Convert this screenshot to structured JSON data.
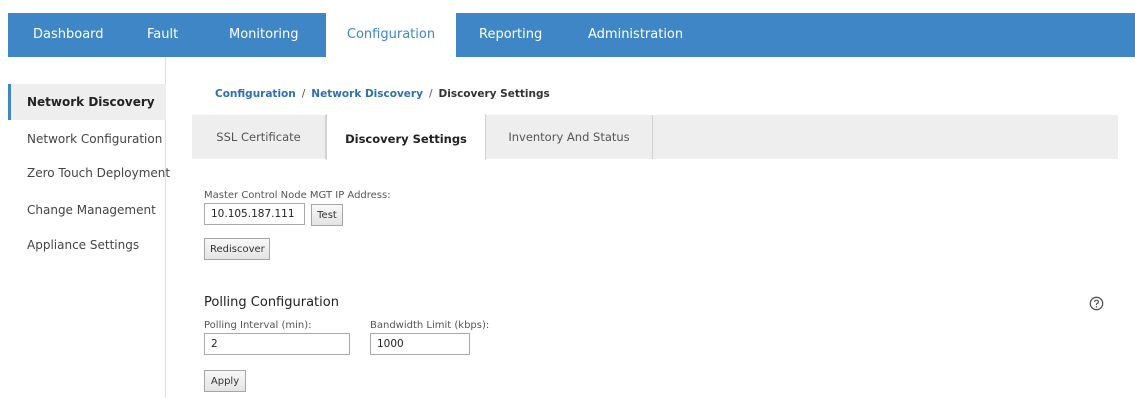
{
  "nav": {
    "items": [
      {
        "label": "Dashboard"
      },
      {
        "label": "Fault"
      },
      {
        "label": "Monitoring"
      },
      {
        "label": "Configuration"
      },
      {
        "label": "Reporting"
      },
      {
        "label": "Administration"
      }
    ],
    "active": "Configuration"
  },
  "sidebar": {
    "items": [
      {
        "label": "Network Discovery"
      },
      {
        "label": "Network Configuration"
      },
      {
        "label": "Zero Touch Deployment"
      },
      {
        "label": "Change Management"
      },
      {
        "label": "Appliance Settings"
      }
    ],
    "active": "Network Discovery"
  },
  "breadcrumb": {
    "items": [
      {
        "label": "Configuration"
      },
      {
        "label": "Network Discovery"
      }
    ],
    "separator": "/",
    "current": "Discovery Settings"
  },
  "tabs": {
    "items": [
      {
        "label": "SSL Certificate"
      },
      {
        "label": "Discovery Settings"
      },
      {
        "label": "Inventory And Status"
      }
    ],
    "active": "Discovery Settings"
  },
  "discovery": {
    "mcn_label": "Master Control Node MGT IP Address:",
    "mcn_value": "10.105.187.111",
    "test_label": "Test",
    "rediscover_label": "Rediscover"
  },
  "polling": {
    "title": "Polling Configuration",
    "interval_label": "Polling Interval (min):",
    "interval_value": "2",
    "bandwidth_label": "Bandwidth Limit (kbps):",
    "bandwidth_value": "1000",
    "apply_label": "Apply"
  },
  "colors": {
    "nav_bg": "#3f86c7",
    "link": "#2e6fb0",
    "active_bg": "#eeeeee"
  },
  "icons": {
    "help": "help-circle-icon"
  }
}
